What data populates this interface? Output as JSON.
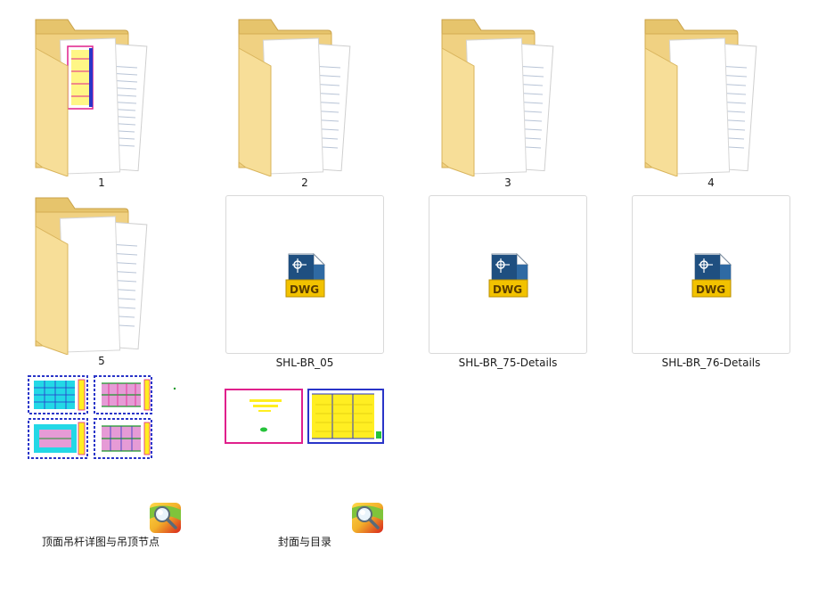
{
  "folders": [
    {
      "label": "1",
      "preview": true
    },
    {
      "label": "2",
      "preview": false
    },
    {
      "label": "3",
      "preview": false
    },
    {
      "label": "4",
      "preview": false
    },
    {
      "label": "5",
      "preview": false
    }
  ],
  "dwg_files": [
    {
      "label": "SHL-BR_05",
      "badge": "DWG"
    },
    {
      "label": "SHL-BR_75-Details",
      "badge": "DWG"
    },
    {
      "label": "SHL-BR_76-Details",
      "badge": "DWG"
    }
  ],
  "image_files": [
    {
      "label": "顶面吊杆详图与吊顶节点",
      "icon": "acdsee-viewer-icon"
    },
    {
      "label": "封面与目录",
      "icon": "acdsee-viewer-icon"
    }
  ],
  "colors": {
    "folder_back": "#e8c874",
    "folder_front": "#f6dd95",
    "folder_edge": "#d4ad52",
    "dwg_blue": "#1f4f80",
    "dwg_gold": "#f2c200",
    "cad_cyan": "#23d8e6",
    "cad_magenta": "#e0208c",
    "cad_yellow": "#ffee22",
    "cad_blue": "#2a35c8"
  }
}
